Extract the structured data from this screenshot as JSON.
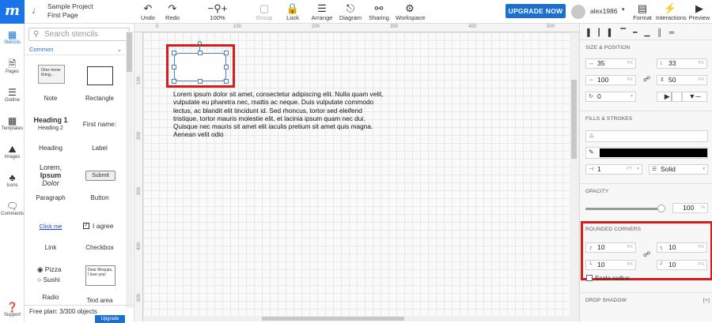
{
  "toolbar": {
    "project_name": "Sample Project",
    "page_name": "First Page",
    "undo": "Undo",
    "redo": "Redo",
    "zoom": "100%",
    "group": "Group",
    "lock": "Lock",
    "arrange": "Arrange",
    "diagram": "Diagram",
    "sharing": "Sharing",
    "workspace": "Workspace",
    "upgrade": "UPGRADE NOW",
    "user": "alex1986",
    "format": "Format",
    "interactions": "Interactions",
    "preview": "Preview"
  },
  "rail": {
    "stencils": "Stencils",
    "pages": "Pages",
    "outline": "Outline",
    "templates": "Templates",
    "images": "Images",
    "icons": "Icons",
    "comments": "Comments",
    "support": "Support"
  },
  "stencils": {
    "search_placeholder": "Search stencils",
    "category": "Common",
    "items": {
      "note": "Note",
      "rectangle": "Rectangle",
      "heading": "Heading",
      "label": "Label",
      "paragraph": "Paragraph",
      "button": "Button",
      "link": "Link",
      "checkbox": "Checkbox",
      "radio": "Radio",
      "textarea": "Text area"
    },
    "previews": {
      "note_text": "One more thing...",
      "heading1": "Heading 1",
      "heading2": "Heading 2",
      "label_text": "First name:",
      "para1": "Lorem,",
      "para2": "Ipsum",
      "para3": "Dolor",
      "button_text": "Submit",
      "link_text": "Click me",
      "checkbox_text": "I agree",
      "radio1": "Pizza",
      "radio2": "Sushi",
      "textarea_text": "Dear Moqups, I love you!"
    },
    "plan_text": "Free plan: 3/300 objects",
    "upgrade_small": "Upgrade"
  },
  "canvas": {
    "ruler_top": [
      "0",
      "100",
      "200",
      "300",
      "400",
      "500"
    ],
    "ruler_left": [
      "100",
      "200",
      "300",
      "400",
      "500"
    ],
    "lorem": "Lorem ipsum dolor sit amet, consectetur adipiscing elit. Nulla quam velit, vulputate eu pharetra nec, mattis ac neque. Duis vulputate commodo lectus, ac blandit elit tincidunt id. Sed rhoncus, tortor sed eleifend tristique, tortor mauris molestie elit, et lacinia ipsum quam nec dui. Quisque nec mauris sit amet elit iaculis pretium sit amet quis magna. Aenean velit odio"
  },
  "props": {
    "size_position": "SIZE & POSITION",
    "x": "35",
    "y": "33",
    "w": "100",
    "h": "50",
    "rotation": "0",
    "unit": "PX",
    "fills_strokes": "FILLS & STROKES",
    "stroke_width": "1",
    "stroke_unit": "PT",
    "stroke_style": "Solid",
    "opacity_label": "OPACITY",
    "opacity": "100",
    "opacity_unit": "%",
    "opacity_level": 1.0,
    "rounded_corners": "ROUNDED CORNERS",
    "r_tl": "10",
    "r_tr": "10",
    "r_bl": "10",
    "r_br": "10",
    "scale_radius": "Scale radius",
    "drop_shadow": "DROP SHADOW",
    "drop_shadow_add": "[+]"
  },
  "colors": {
    "accent": "#1a6fd1",
    "highlight": "#d71c1c",
    "stroke_color": "#000000"
  }
}
